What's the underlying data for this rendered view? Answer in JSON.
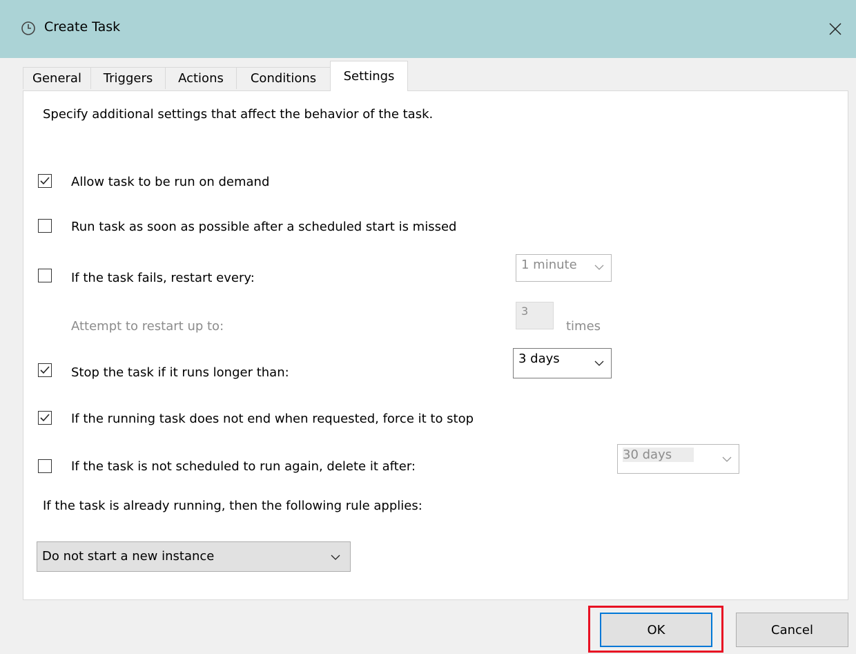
{
  "window": {
    "title": "Create Task",
    "close_icon": "close-icon",
    "title_icon": "clock-icon"
  },
  "tabs": [
    {
      "label": "General"
    },
    {
      "label": "Triggers"
    },
    {
      "label": "Actions"
    },
    {
      "label": "Conditions"
    },
    {
      "label": "Settings",
      "active": true
    }
  ],
  "settings": {
    "description": "Specify additional settings that affect the behavior of the task.",
    "allow_on_demand": {
      "label": "Allow task to be run on demand",
      "checked": true
    },
    "run_asap": {
      "label": "Run task as soon as possible after a scheduled start is missed",
      "checked": false
    },
    "restart_on_fail": {
      "label": "If the task fails, restart every:",
      "checked": false,
      "value": "1 minute"
    },
    "attempt_restart": {
      "label": "Attempt to restart up to:",
      "value": "3",
      "suffix": "times"
    },
    "stop_if_longer": {
      "label": "Stop the task if it runs longer than:",
      "checked": true,
      "value": "3 days"
    },
    "force_stop": {
      "label": "If the running task does not end when requested, force it to stop",
      "checked": true
    },
    "delete_after": {
      "label": "If the task is not scheduled to run again, delete it after:",
      "checked": false,
      "value": "30 days"
    },
    "rule_label": "If the task is already running, then the following rule applies:",
    "rule_value": "Do not start a new instance"
  },
  "buttons": {
    "ok": "OK",
    "cancel": "Cancel"
  },
  "colors": {
    "titlebar": "#abd3d6",
    "highlight": "#e81123",
    "focus": "#0078d7"
  }
}
